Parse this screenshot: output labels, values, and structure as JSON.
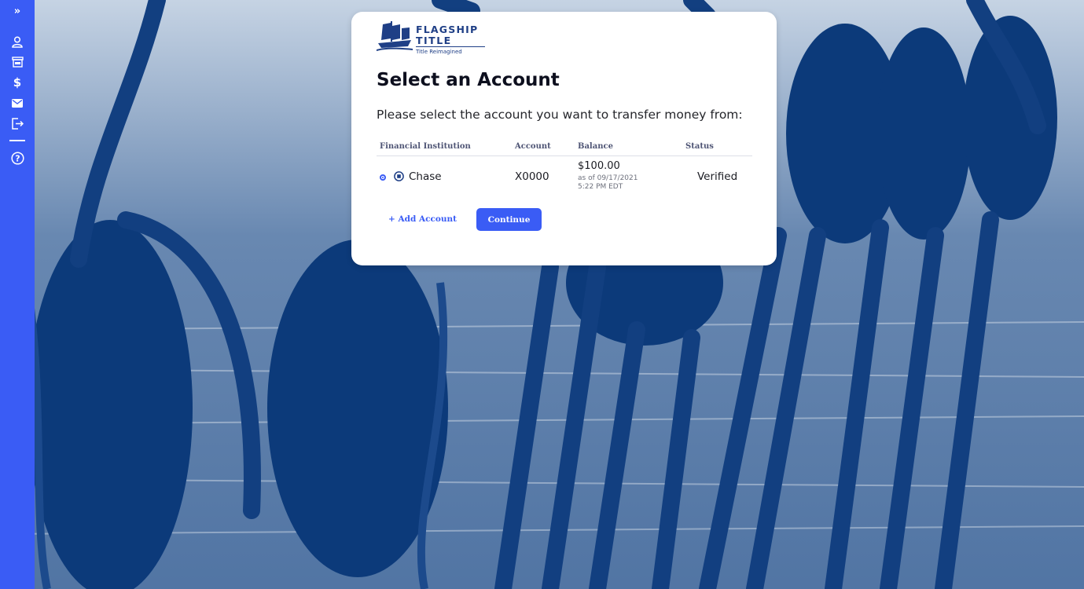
{
  "sidebar": {
    "items": [
      {
        "icon": "chevrons-right-icon",
        "label": "»"
      },
      {
        "icon": "user-icon"
      },
      {
        "icon": "storefront-icon"
      },
      {
        "icon": "dollar-icon",
        "label": "$"
      },
      {
        "icon": "mail-icon"
      },
      {
        "icon": "logout-icon"
      },
      {
        "icon": "help-icon",
        "label": "?"
      }
    ],
    "color": "#3a5cf5"
  },
  "logo": {
    "line1": "FLAGSHIP",
    "line2": "TITLE",
    "tagline": "Title Reimagined"
  },
  "card": {
    "title": "Select an Account",
    "subtitle": "Please select the account you want to transfer money from:",
    "columns": [
      "Financial Institution",
      "Account",
      "Balance",
      "Status"
    ],
    "rows": [
      {
        "institution": "Chase",
        "account": "X0000",
        "balance": "$100.00",
        "as_of_line1": "as of 09/17/2021",
        "as_of_line2": "5:22 PM EDT",
        "status": "Verified",
        "selected": true
      }
    ],
    "add_account_label": "+ Add Account",
    "continue_label": "Continue"
  },
  "colors": {
    "accent": "#3a5cf5",
    "background_tint": "#0c3a7a"
  }
}
